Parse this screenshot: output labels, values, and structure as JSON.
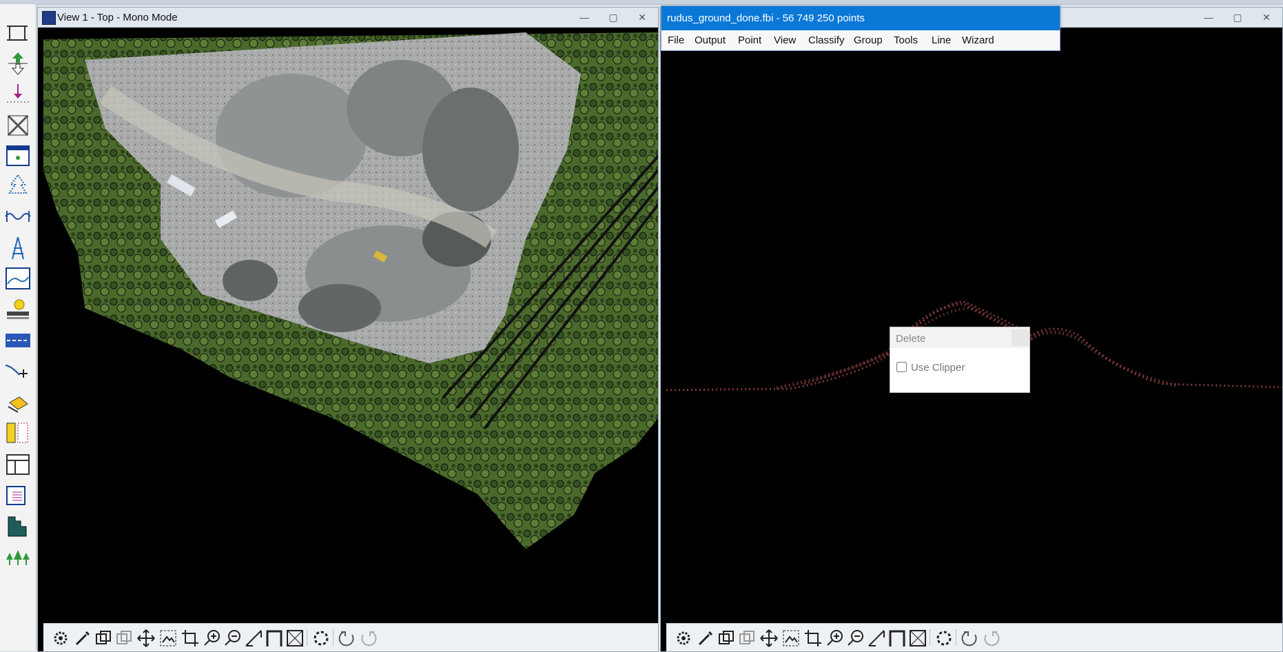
{
  "view1": {
    "title": "View 1 - Top - Mono Mode",
    "buttons": {
      "minimize": "—",
      "maximize": "▢",
      "close": "✕"
    }
  },
  "view2": {
    "buttons": {
      "minimize": "—",
      "maximize": "▢",
      "close": "✕"
    }
  },
  "menu_window": {
    "title": "rudus_ground_done.fbi - 56 749 250 points",
    "menu": [
      "File",
      "Output",
      "Point",
      "View",
      "Classify",
      "Group",
      "Tools",
      "Line",
      "Wizard"
    ]
  },
  "delete_dialog": {
    "title": "Delete",
    "use_clipper_label": "Use Clipper",
    "use_clipper_checked": false
  },
  "view_toolbar_icons": [
    "settings-icon",
    "brush-icon",
    "copy-icon",
    "copy-faded-icon",
    "pan-icon",
    "fit-icon",
    "crop-icon",
    "zoom-in-icon",
    "zoom-out-icon",
    "measure-icon",
    "frame-icon",
    "box-icon",
    "gear-spin-icon",
    "undo-icon",
    "redo-icon"
  ],
  "palette_icons": [
    "wire-icon",
    "move-updown-icon",
    "point-icon",
    "swap-icon",
    "window-icon",
    "tree-icon",
    "wave-icon",
    "tower-icon",
    "profile-icon",
    "bulb-icon",
    "road-icon",
    "line-plus-icon",
    "eraser-icon",
    "layer-icon",
    "layout-icon",
    "report-icon",
    "bars-icon",
    "forest-icon"
  ],
  "colors": {
    "title_blue": "#0a78d7",
    "profile_points": "#7b3a38",
    "window_chrome": "#dfe6ee"
  }
}
